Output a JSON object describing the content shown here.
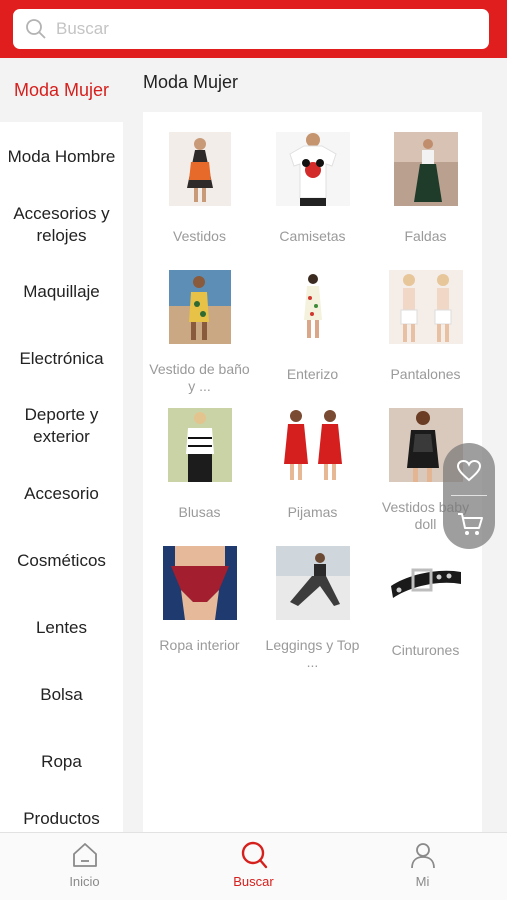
{
  "search": {
    "placeholder": "Buscar"
  },
  "sidebar": {
    "items": [
      {
        "label": "Moda Mujer",
        "active": true
      },
      {
        "label": "Moda Hombre"
      },
      {
        "label": "Accesorios y relojes"
      },
      {
        "label": "Maquillaje"
      },
      {
        "label": "Electrónica"
      },
      {
        "label": "Deporte y exterior"
      },
      {
        "label": "Accesorio"
      },
      {
        "label": "Cosméticos"
      },
      {
        "label": "Lentes"
      },
      {
        "label": "Bolsa"
      },
      {
        "label": "Ropa"
      },
      {
        "label": "Productos"
      }
    ]
  },
  "panel": {
    "title": "Moda Mujer"
  },
  "categories": [
    {
      "label": "Vestidos"
    },
    {
      "label": "Camisetas"
    },
    {
      "label": "Faldas"
    },
    {
      "label": "Vestido de baño y ..."
    },
    {
      "label": "Enterizo"
    },
    {
      "label": "Pantalones"
    },
    {
      "label": "Blusas"
    },
    {
      "label": "Pijamas"
    },
    {
      "label": "Vestidos baby doll"
    },
    {
      "label": "Ropa interior"
    },
    {
      "label": "Leggings y Top ..."
    },
    {
      "label": "Cinturones"
    }
  ],
  "fab": {
    "icons": [
      "heart-icon",
      "cart-icon"
    ]
  },
  "bottom_nav": {
    "items": [
      {
        "label": "Inicio",
        "icon": "home-icon"
      },
      {
        "label": "Buscar",
        "icon": "search-icon",
        "active": true
      },
      {
        "label": "Mi",
        "icon": "user-icon"
      }
    ]
  },
  "colors": {
    "accent": "#e01e1e",
    "active_text": "#d6201d",
    "panel_bg": "#f3f3f3"
  }
}
